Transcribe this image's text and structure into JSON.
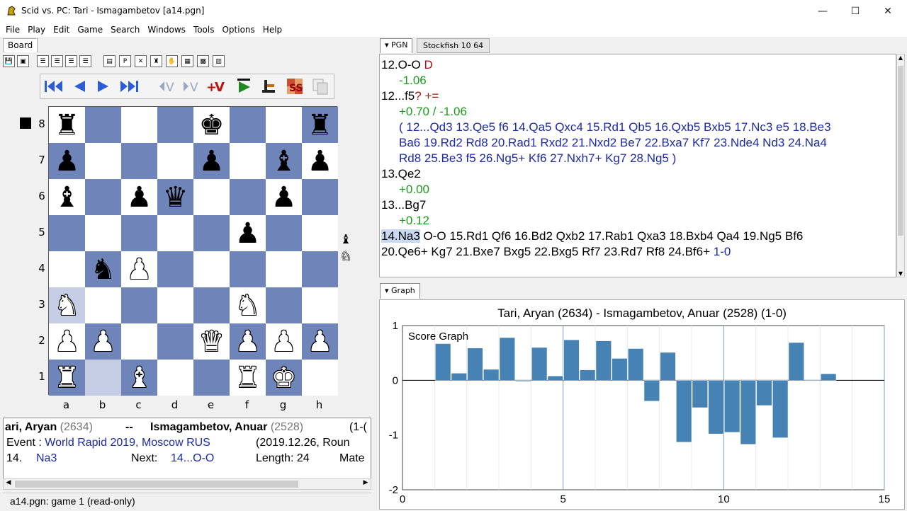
{
  "window": {
    "title": "Scid vs. PC: Tari - Ismagambetov [a14.pgn]",
    "min": "—",
    "max": "☐",
    "close": "✕"
  },
  "menu": [
    "File",
    "Play",
    "Edit",
    "Game",
    "Search",
    "Windows",
    "Tools",
    "Options",
    "Help"
  ],
  "board_tab": "Board",
  "ranks": [
    "8",
    "7",
    "6",
    "5",
    "4",
    "3",
    "2",
    "1"
  ],
  "files": [
    "a",
    "b",
    "c",
    "d",
    "e",
    "f",
    "g",
    "h"
  ],
  "board_fen_rows": [
    "r...k..r",
    "p...p.bp",
    "b.pq..p.",
    ".....p..",
    ".nP.....",
    "N....N..",
    "PP..QPPP",
    "R.B..RK."
  ],
  "highlight_squares": [
    "a3",
    "b1"
  ],
  "material": {
    "bishop": "♝",
    "knight": "♘"
  },
  "info": {
    "white_name": "ari, Aryan",
    "white_elo": "(2634)",
    "sep": "--",
    "black_name": "Ismagambetov, Anuar",
    "black_elo": "(2528)",
    "result_cut": "(1-(",
    "event_label": "Event :",
    "event_value": "World Rapid 2019, Moscow RUS",
    "event_date": "(2019.12.26, Roun",
    "move_no": "14.",
    "move": "Na3",
    "next_label": "Next:",
    "next_move": "14...O-O",
    "length": "Length: 24",
    "mate": "Mate"
  },
  "status": "a14.pgn: game  1     (read-only)",
  "tabs": {
    "pgn": "PGN",
    "engine": "Stockfish 10 64",
    "graph": "Graph"
  },
  "pgn_lines": [
    {
      "parts": [
        {
          "t": "12.O-O ",
          "c": "mv"
        },
        {
          "t": "D",
          "c": "nag"
        }
      ],
      "indent": false
    },
    {
      "parts": [
        {
          "t": "-1.06",
          "c": "ev"
        }
      ],
      "indent": true
    },
    {
      "parts": [
        {
          "t": "12...f5",
          "c": "mv"
        },
        {
          "t": "? +=",
          "c": "nag"
        }
      ],
      "indent": false
    },
    {
      "parts": [
        {
          "t": "+0.70 / -1.06",
          "c": "ev"
        }
      ],
      "indent": true
    },
    {
      "parts": [
        {
          "t": "( 12...Qd3 13.Qe5 f6 14.Qa5 Qxc4 15.Rd1 Qb5 16.Qxb5 Bxb5 17.Nc3 e5 18.Be3",
          "c": "va"
        }
      ],
      "indent": true
    },
    {
      "parts": [
        {
          "t": "Ba6 19.Rd2 Rd8 20.Rad1 Rxd2 21.Nxd2 Be7 22.Bxa7 Kf7 23.Nde4 Nd3 24.Na4",
          "c": "va"
        }
      ],
      "indent": true
    },
    {
      "parts": [
        {
          "t": "Rd8 25.Be3 f5 26.Ng5+ Kf6 27.Nxh7+ Kg7 28.Ng5 )",
          "c": "va"
        }
      ],
      "indent": true
    },
    {
      "parts": [
        {
          "t": "13.Qe2",
          "c": "mv"
        }
      ],
      "indent": false
    },
    {
      "parts": [
        {
          "t": "+0.00",
          "c": "ev"
        }
      ],
      "indent": true
    },
    {
      "parts": [
        {
          "t": "13...Bg7",
          "c": "mv"
        }
      ],
      "indent": false
    },
    {
      "parts": [
        {
          "t": "+0.12",
          "c": "ev"
        }
      ],
      "indent": true
    },
    {
      "parts": [
        {
          "t": "14.Na3",
          "c": "mv cur"
        },
        {
          "t": " O-O 15.Rd1 Qf6 16.Bd2 Qxb2 17.Rab1 Qxa3 18.Bxb4 Qa4 19.Ng5 Bf6",
          "c": "mv"
        }
      ],
      "indent": false
    },
    {
      "parts": [
        {
          "t": "20.Qe6+ Kg7 21.Bxe7 Bxg5 22.Bxg5 Rf7 23.Rd7 Rf8 24.Bf6+ ",
          "c": "mv"
        },
        {
          "t": "1-0",
          "c": "va"
        }
      ],
      "indent": false
    }
  ],
  "chart_data": {
    "type": "bar",
    "title": "Tari, Aryan (2634) - Ismagambetov, Anuar (2528) (1-0)",
    "legend": "Score Graph",
    "xlim": [
      0,
      15
    ],
    "ylim": [
      -2,
      1
    ],
    "xticks": [
      0,
      5,
      10,
      15
    ],
    "yticks": [
      1,
      0,
      -1,
      -2
    ],
    "x": [
      1.5,
      2,
      2.5,
      3,
      3.5,
      4,
      4.5,
      5,
      5.5,
      6,
      6.5,
      7,
      7.5,
      8,
      8.5,
      9,
      9.5,
      10,
      10.5,
      11,
      11.5,
      12,
      12.5,
      13,
      13.5
    ],
    "values": [
      0.67,
      0.13,
      0.59,
      0.2,
      0.78,
      -0.02,
      0.6,
      0.08,
      0.74,
      0.19,
      0.72,
      0.4,
      0.58,
      -0.38,
      0.51,
      -1.13,
      -0.5,
      -0.98,
      -0.95,
      -1.17,
      -0.46,
      -1.05,
      0.69,
      0.0,
      0.12
    ],
    "color": "#4682b4"
  }
}
